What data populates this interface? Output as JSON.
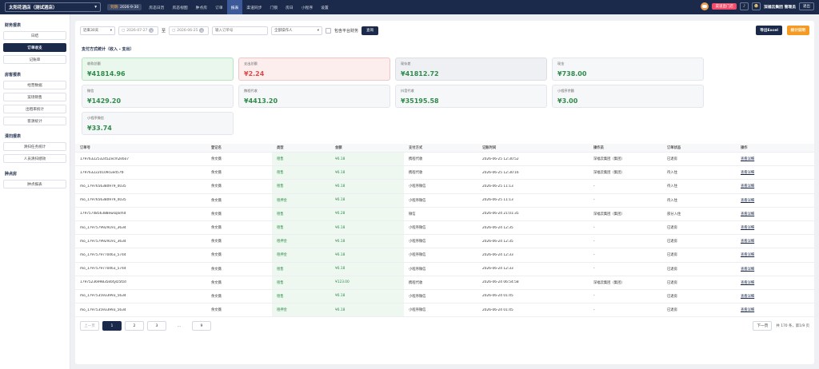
{
  "topbar": {
    "hotel_name": "太阳花酒店（测试酒店）",
    "date_key": "到期:",
    "date_val": "2026-9-30",
    "nav": [
      "房态日历",
      "房态视图",
      "肿点房",
      "订单",
      "报表",
      "渠道同步",
      "门锁",
      "房日",
      "小程序",
      "设置"
    ],
    "active_nav": "报表",
    "promo": "渠道直门店",
    "manager": "深福云集团 管理员",
    "logout": "退出"
  },
  "sidebar": {
    "sections": [
      {
        "title": "财务报表",
        "items": [
          "日结",
          "订单收支",
          "记账单"
        ]
      },
      {
        "title": "房客报表",
        "items": [
          "经营数据",
          "案场销售",
          "出租率统计",
          "客源统计"
        ]
      },
      {
        "title": "清扫报表",
        "items": [
          "清扫任务统计",
          "人员清扫绩效"
        ]
      },
      {
        "title": "肿点房",
        "items": [
          "肿点报表"
        ]
      }
    ],
    "active_item": "订单收支"
  },
  "filter": {
    "range": "近来30天",
    "start_date": "2026-07-27",
    "to": "至",
    "end_date": "2026-06-25",
    "order_placeholder": "输入订单号",
    "operator": "全部操作人",
    "include_deleted": "包含平台财务",
    "query": "查询",
    "export": "导出Excel",
    "stats": "统计说明"
  },
  "pay": {
    "title": "支付方式统计（收入 - 支出）",
    "cards": [
      {
        "label": "收款总额",
        "value": "¥41814.96",
        "style": "green"
      },
      {
        "label": "支出总额",
        "value": "¥2.24",
        "style": "red"
      },
      {
        "label": "现存差",
        "value": "¥41812.72",
        "style": "grey"
      },
      {
        "label": "现金",
        "value": "¥738.00",
        "style": ""
      },
      {
        "label": "微信",
        "value": "¥1429.20",
        "style": ""
      },
      {
        "label": "携程代收",
        "value": "¥4413.20",
        "style": ""
      },
      {
        "label": "抖音代收",
        "value": "¥35195.58",
        "style": ""
      },
      {
        "label": "小程序余额",
        "value": "¥3.00",
        "style": ""
      },
      {
        "label": "小程序微信",
        "value": "¥33.74",
        "style": ""
      }
    ]
  },
  "table": {
    "headers": [
      "订单号",
      "登记名",
      "类型",
      "金额",
      "支付方式",
      "记账时间",
      "操作员",
      "订单状态",
      "操作"
    ],
    "rows": [
      [
        "1797632253245Zecm2k6o7",
        "余文薇",
        "租售",
        "¥6.18",
        "携程代收",
        "2026-06-25 12:30:52",
        "深福云集团（集团）",
        "已退房",
        "查看详细"
      ],
      [
        "1797632220109cued57tF",
        "余文薇",
        "租售",
        "¥6.18",
        "携程代收",
        "2026-06-25 12:30:16",
        "深福云集团（集团）",
        "待入住",
        "查看详细"
      ],
      [
        "mo_1797656380979_4035",
        "余文薇",
        "租售",
        "¥6.18",
        "小程序微信",
        "2026-06-25 11:13",
        "-",
        "待入住",
        "查看详细"
      ],
      [
        "mo_1797656380979_4035",
        "余文薇",
        "租押金",
        "¥6.18",
        "小程序微信",
        "2026-06-25 11:13",
        "-",
        "待入住",
        "查看详细"
      ],
      [
        "1797574856388ewsqlxmd",
        "余文薇",
        "租售",
        "¥6.28",
        "微信",
        "2026-06-24 21:01:35",
        "深福云集团（集团）",
        "部分入住",
        "查看详细"
      ],
      [
        "mo_1797579929191_3634",
        "余文薇",
        "租售",
        "¥6.18",
        "小程序微信",
        "2026-06-24 12:35",
        "-",
        "已退房",
        "查看详细"
      ],
      [
        "mo_1797579929191_3634",
        "余文薇",
        "租押金",
        "¥6.18",
        "小程序微信",
        "2026-06-24 12:35",
        "-",
        "已退房",
        "查看详细"
      ],
      [
        "mo_1797579770463_5744",
        "余文薇",
        "租押金",
        "¥6.18",
        "小程序微信",
        "2026-06-24 12:33",
        "-",
        "已退房",
        "查看详细"
      ],
      [
        "mo_1797579770463_5744",
        "余文薇",
        "租售",
        "¥6.18",
        "小程序微信",
        "2026-06-24 12:33",
        "-",
        "已退房",
        "查看详细"
      ],
      [
        "1797523699835k6tylz5fzd",
        "余文薇",
        "租售",
        "¥123.00",
        "携程代收",
        "2026-06-24 06:54:58",
        "深福云集团（集团）",
        "已退房",
        "查看详细"
      ],
      [
        "mo_1797535933993_5634",
        "余文薇",
        "租售",
        "¥6.18",
        "小程序微信",
        "2026-06-24 01:45",
        "-",
        "已退房",
        "查看详细"
      ],
      [
        "mo_1797535933993_5634",
        "余文薇",
        "租押金",
        "¥6.18",
        "小程序微信",
        "2026-06-24 01:45",
        "-",
        "已退房",
        "查看详细"
      ]
    ]
  },
  "pager": {
    "prev": "上一页",
    "pages": [
      "1",
      "2",
      "3",
      "...",
      "9"
    ],
    "active": "1",
    "next": "下一页",
    "summary": "共 170 条，第1/9 页"
  },
  "colors": {
    "nav_bg": "#1b2a4a",
    "active": "#3c5a99",
    "green": "#2e8b4a",
    "red": "#e04848",
    "export": "#1b2a4a",
    "stats": "#f59a23"
  }
}
